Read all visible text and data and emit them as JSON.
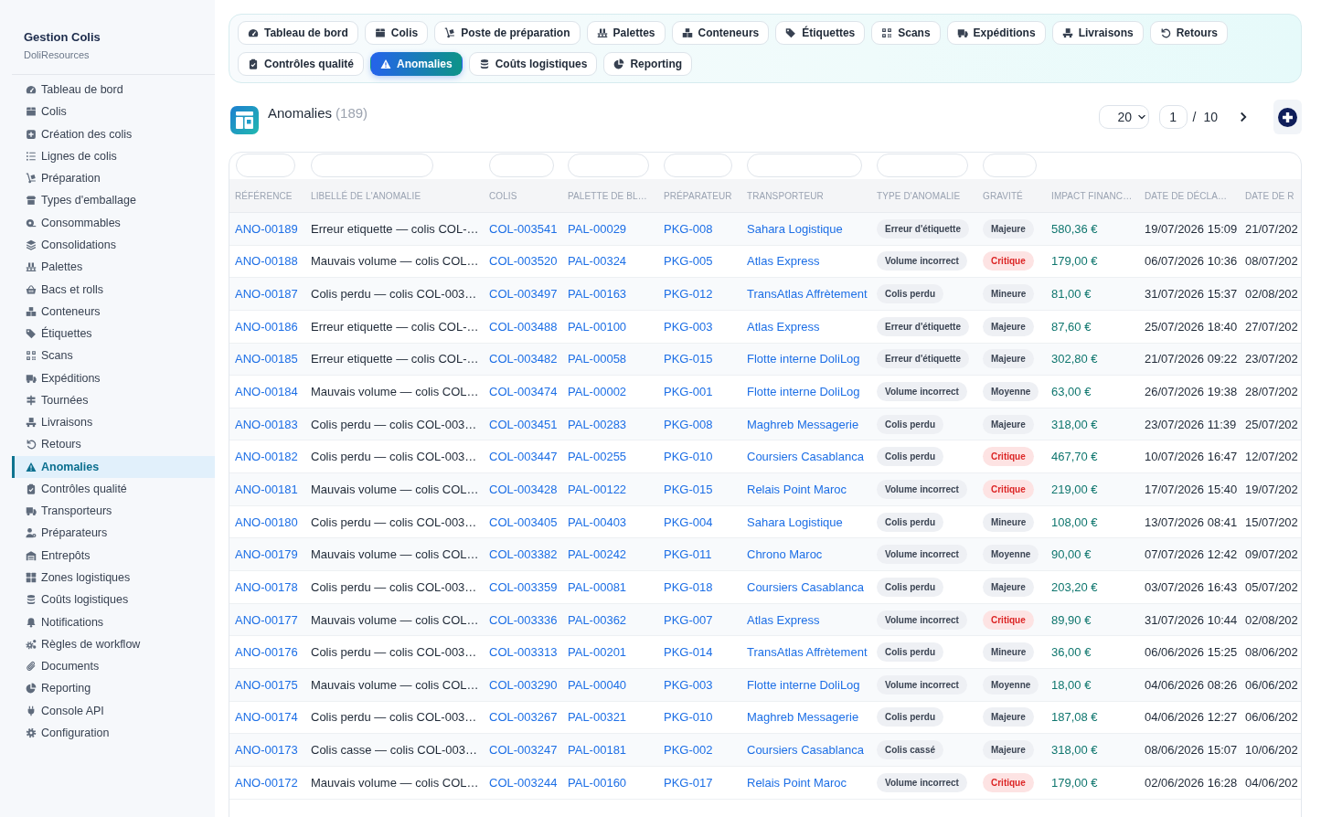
{
  "sidebar": {
    "title": "Gestion Colis",
    "subtitle": "DoliResources",
    "items": [
      {
        "label": "Tableau de bord",
        "selected": false
      },
      {
        "label": "Colis",
        "selected": false
      },
      {
        "label": "Création des colis",
        "selected": false
      },
      {
        "label": "Lignes de colis",
        "selected": false
      },
      {
        "label": "Préparation",
        "selected": false
      },
      {
        "label": "Types d'emballage",
        "selected": false
      },
      {
        "label": "Consommables",
        "selected": false
      },
      {
        "label": "Consolidations",
        "selected": false
      },
      {
        "label": "Palettes",
        "selected": false
      },
      {
        "label": "Bacs et rolls",
        "selected": false
      },
      {
        "label": "Conteneurs",
        "selected": false
      },
      {
        "label": "Étiquettes",
        "selected": false
      },
      {
        "label": "Scans",
        "selected": false
      },
      {
        "label": "Expéditions",
        "selected": false
      },
      {
        "label": "Tournées",
        "selected": false
      },
      {
        "label": "Livraisons",
        "selected": false
      },
      {
        "label": "Retours",
        "selected": false
      },
      {
        "label": "Anomalies",
        "selected": true
      },
      {
        "label": "Contrôles qualité",
        "selected": false
      },
      {
        "label": "Transporteurs",
        "selected": false
      },
      {
        "label": "Préparateurs",
        "selected": false
      },
      {
        "label": "Entrepôts",
        "selected": false
      },
      {
        "label": "Zones logistiques",
        "selected": false
      },
      {
        "label": "Coûts logistiques",
        "selected": false
      },
      {
        "label": "Notifications",
        "selected": false
      },
      {
        "label": "Règles de workflow",
        "selected": false
      },
      {
        "label": "Documents",
        "selected": false
      },
      {
        "label": "Reporting",
        "selected": false
      },
      {
        "label": "Console API",
        "selected": false
      },
      {
        "label": "Configuration",
        "selected": false
      }
    ]
  },
  "tabs": [
    {
      "label": "Tableau de bord",
      "selected": false
    },
    {
      "label": "Colis",
      "selected": false
    },
    {
      "label": "Poste de préparation",
      "selected": false
    },
    {
      "label": "Palettes",
      "selected": false
    },
    {
      "label": "Conteneurs",
      "selected": false
    },
    {
      "label": "Étiquettes",
      "selected": false
    },
    {
      "label": "Scans",
      "selected": false
    },
    {
      "label": "Expéditions",
      "selected": false
    },
    {
      "label": "Livraisons",
      "selected": false
    },
    {
      "label": "Retours",
      "selected": false
    },
    {
      "label": "Contrôles qualité",
      "selected": false
    },
    {
      "label": "Anomalies",
      "selected": true
    },
    {
      "label": "Coûts logistiques",
      "selected": false
    },
    {
      "label": "Reporting",
      "selected": false
    }
  ],
  "header": {
    "title": "Anomalies",
    "count": "(189)",
    "page_size": "20",
    "page": "1",
    "separator": "/",
    "total_pages": "10"
  },
  "table": {
    "columns": [
      {
        "label": "RÉFÉRENCE",
        "kind": "link",
        "filter": true
      },
      {
        "label": "LIBELLÉ DE L'ANOMALIE",
        "kind": "text",
        "filter": true
      },
      {
        "label": "COLIS",
        "kind": "link",
        "filter": true
      },
      {
        "label": "PALETTE DE BL…",
        "kind": "link",
        "filter": true
      },
      {
        "label": "PRÉPARATEUR",
        "kind": "link",
        "filter": true
      },
      {
        "label": "TRANSPORTEUR",
        "kind": "link",
        "filter": true
      },
      {
        "label": "TYPE D'ANOMALIE",
        "kind": "badge",
        "filter": true
      },
      {
        "label": "GRAVITÉ",
        "kind": "severity",
        "filter": true
      },
      {
        "label": "IMPACT FINANC…",
        "kind": "amount",
        "filter": false
      },
      {
        "label": "DATE DE DÉCLA…",
        "kind": "text",
        "filter": false
      },
      {
        "label": "DATE DE R",
        "kind": "text",
        "filter": false
      }
    ],
    "rows": [
      {
        "cells": [
          "ANO-00189",
          "Erreur etiquette — colis COL-…",
          "COL-003541",
          "PAL-00029",
          "PKG-008",
          "Sahara Logistique",
          "Erreur d'étiquette",
          "Majeure",
          "580,36 €",
          "19/07/2026 15:09",
          "21/07/202"
        ],
        "critical": false
      },
      {
        "cells": [
          "ANO-00188",
          "Mauvais volume — colis COL…",
          "COL-003520",
          "PAL-00324",
          "PKG-005",
          "Atlas Express",
          "Volume incorrect",
          "Critique",
          "179,00 €",
          "06/07/2026 10:36",
          "08/07/202"
        ],
        "critical": true
      },
      {
        "cells": [
          "ANO-00187",
          "Colis perdu — colis COL-003…",
          "COL-003497",
          "PAL-00163",
          "PKG-012",
          "TransAtlas Affrètement",
          "Colis perdu",
          "Mineure",
          "81,00 €",
          "31/07/2026 15:37",
          "02/08/202"
        ],
        "critical": false
      },
      {
        "cells": [
          "ANO-00186",
          "Erreur etiquette — colis COL-…",
          "COL-003488",
          "PAL-00100",
          "PKG-003",
          "Atlas Express",
          "Erreur d'étiquette",
          "Majeure",
          "87,60 €",
          "25/07/2026 18:40",
          "27/07/202"
        ],
        "critical": false
      },
      {
        "cells": [
          "ANO-00185",
          "Erreur etiquette — colis COL-…",
          "COL-003482",
          "PAL-00058",
          "PKG-015",
          "Flotte interne DoliLog",
          "Erreur d'étiquette",
          "Majeure",
          "302,80 €",
          "21/07/2026 09:22",
          "23/07/202"
        ],
        "critical": false
      },
      {
        "cells": [
          "ANO-00184",
          "Mauvais volume — colis COL…",
          "COL-003474",
          "PAL-00002",
          "PKG-001",
          "Flotte interne DoliLog",
          "Volume incorrect",
          "Moyenne",
          "63,00 €",
          "26/07/2026 19:38",
          "28/07/202"
        ],
        "critical": false
      },
      {
        "cells": [
          "ANO-00183",
          "Colis perdu — colis COL-003…",
          "COL-003451",
          "PAL-00283",
          "PKG-008",
          "Maghreb Messagerie",
          "Colis perdu",
          "Majeure",
          "318,00 €",
          "23/07/2026 11:39",
          "25/07/202"
        ],
        "critical": false
      },
      {
        "cells": [
          "ANO-00182",
          "Colis perdu — colis COL-003…",
          "COL-003447",
          "PAL-00255",
          "PKG-010",
          "Coursiers Casablanca",
          "Colis perdu",
          "Critique",
          "467,70 €",
          "10/07/2026 16:47",
          "12/07/202"
        ],
        "critical": true
      },
      {
        "cells": [
          "ANO-00181",
          "Mauvais volume — colis COL…",
          "COL-003428",
          "PAL-00122",
          "PKG-015",
          "Relais Point Maroc",
          "Volume incorrect",
          "Critique",
          "219,00 €",
          "17/07/2026 15:40",
          "19/07/202"
        ],
        "critical": true
      },
      {
        "cells": [
          "ANO-00180",
          "Colis perdu — colis COL-003…",
          "COL-003405",
          "PAL-00403",
          "PKG-004",
          "Sahara Logistique",
          "Colis perdu",
          "Mineure",
          "108,00 €",
          "13/07/2026 08:41",
          "15/07/202"
        ],
        "critical": false
      },
      {
        "cells": [
          "ANO-00179",
          "Mauvais volume — colis COL…",
          "COL-003382",
          "PAL-00242",
          "PKG-011",
          "Chrono Maroc",
          "Volume incorrect",
          "Moyenne",
          "90,00 €",
          "07/07/2026 12:42",
          "09/07/202"
        ],
        "critical": false
      },
      {
        "cells": [
          "ANO-00178",
          "Colis perdu — colis COL-003…",
          "COL-003359",
          "PAL-00081",
          "PKG-018",
          "Coursiers Casablanca",
          "Colis perdu",
          "Majeure",
          "203,20 €",
          "03/07/2026 16:43",
          "05/07/202"
        ],
        "critical": false
      },
      {
        "cells": [
          "ANO-00177",
          "Mauvais volume — colis COL…",
          "COL-003336",
          "PAL-00362",
          "PKG-007",
          "Atlas Express",
          "Volume incorrect",
          "Critique",
          "89,90 €",
          "31/07/2026 10:44",
          "02/08/202"
        ],
        "critical": true
      },
      {
        "cells": [
          "ANO-00176",
          "Colis perdu — colis COL-003…",
          "COL-003313",
          "PAL-00201",
          "PKG-014",
          "TransAtlas Affrètement",
          "Colis perdu",
          "Mineure",
          "36,00 €",
          "06/06/2026 15:25",
          "08/06/202"
        ],
        "critical": false
      },
      {
        "cells": [
          "ANO-00175",
          "Mauvais volume — colis COL…",
          "COL-003290",
          "PAL-00040",
          "PKG-003",
          "Flotte interne DoliLog",
          "Volume incorrect",
          "Moyenne",
          "18,00 €",
          "04/06/2026 08:26",
          "06/06/202"
        ],
        "critical": false
      },
      {
        "cells": [
          "ANO-00174",
          "Colis perdu — colis COL-003…",
          "COL-003267",
          "PAL-00321",
          "PKG-010",
          "Maghreb Messagerie",
          "Colis perdu",
          "Majeure",
          "187,08 €",
          "04/06/2026 12:27",
          "06/06/202"
        ],
        "critical": false
      },
      {
        "cells": [
          "ANO-00173",
          "Colis casse — colis COL-003…",
          "COL-003247",
          "PAL-00181",
          "PKG-002",
          "Coursiers Casablanca",
          "Colis cassé",
          "Majeure",
          "318,00 €",
          "08/06/2026 15:07",
          "10/06/202"
        ],
        "critical": false
      },
      {
        "cells": [
          "ANO-00172",
          "Mauvais volume — colis COL…",
          "COL-003244",
          "PAL-00160",
          "PKG-017",
          "Relais Point Maroc",
          "Volume incorrect",
          "Critique",
          "179,00 €",
          "02/06/2026 16:28",
          "04/06/202"
        ],
        "critical": true
      }
    ]
  }
}
